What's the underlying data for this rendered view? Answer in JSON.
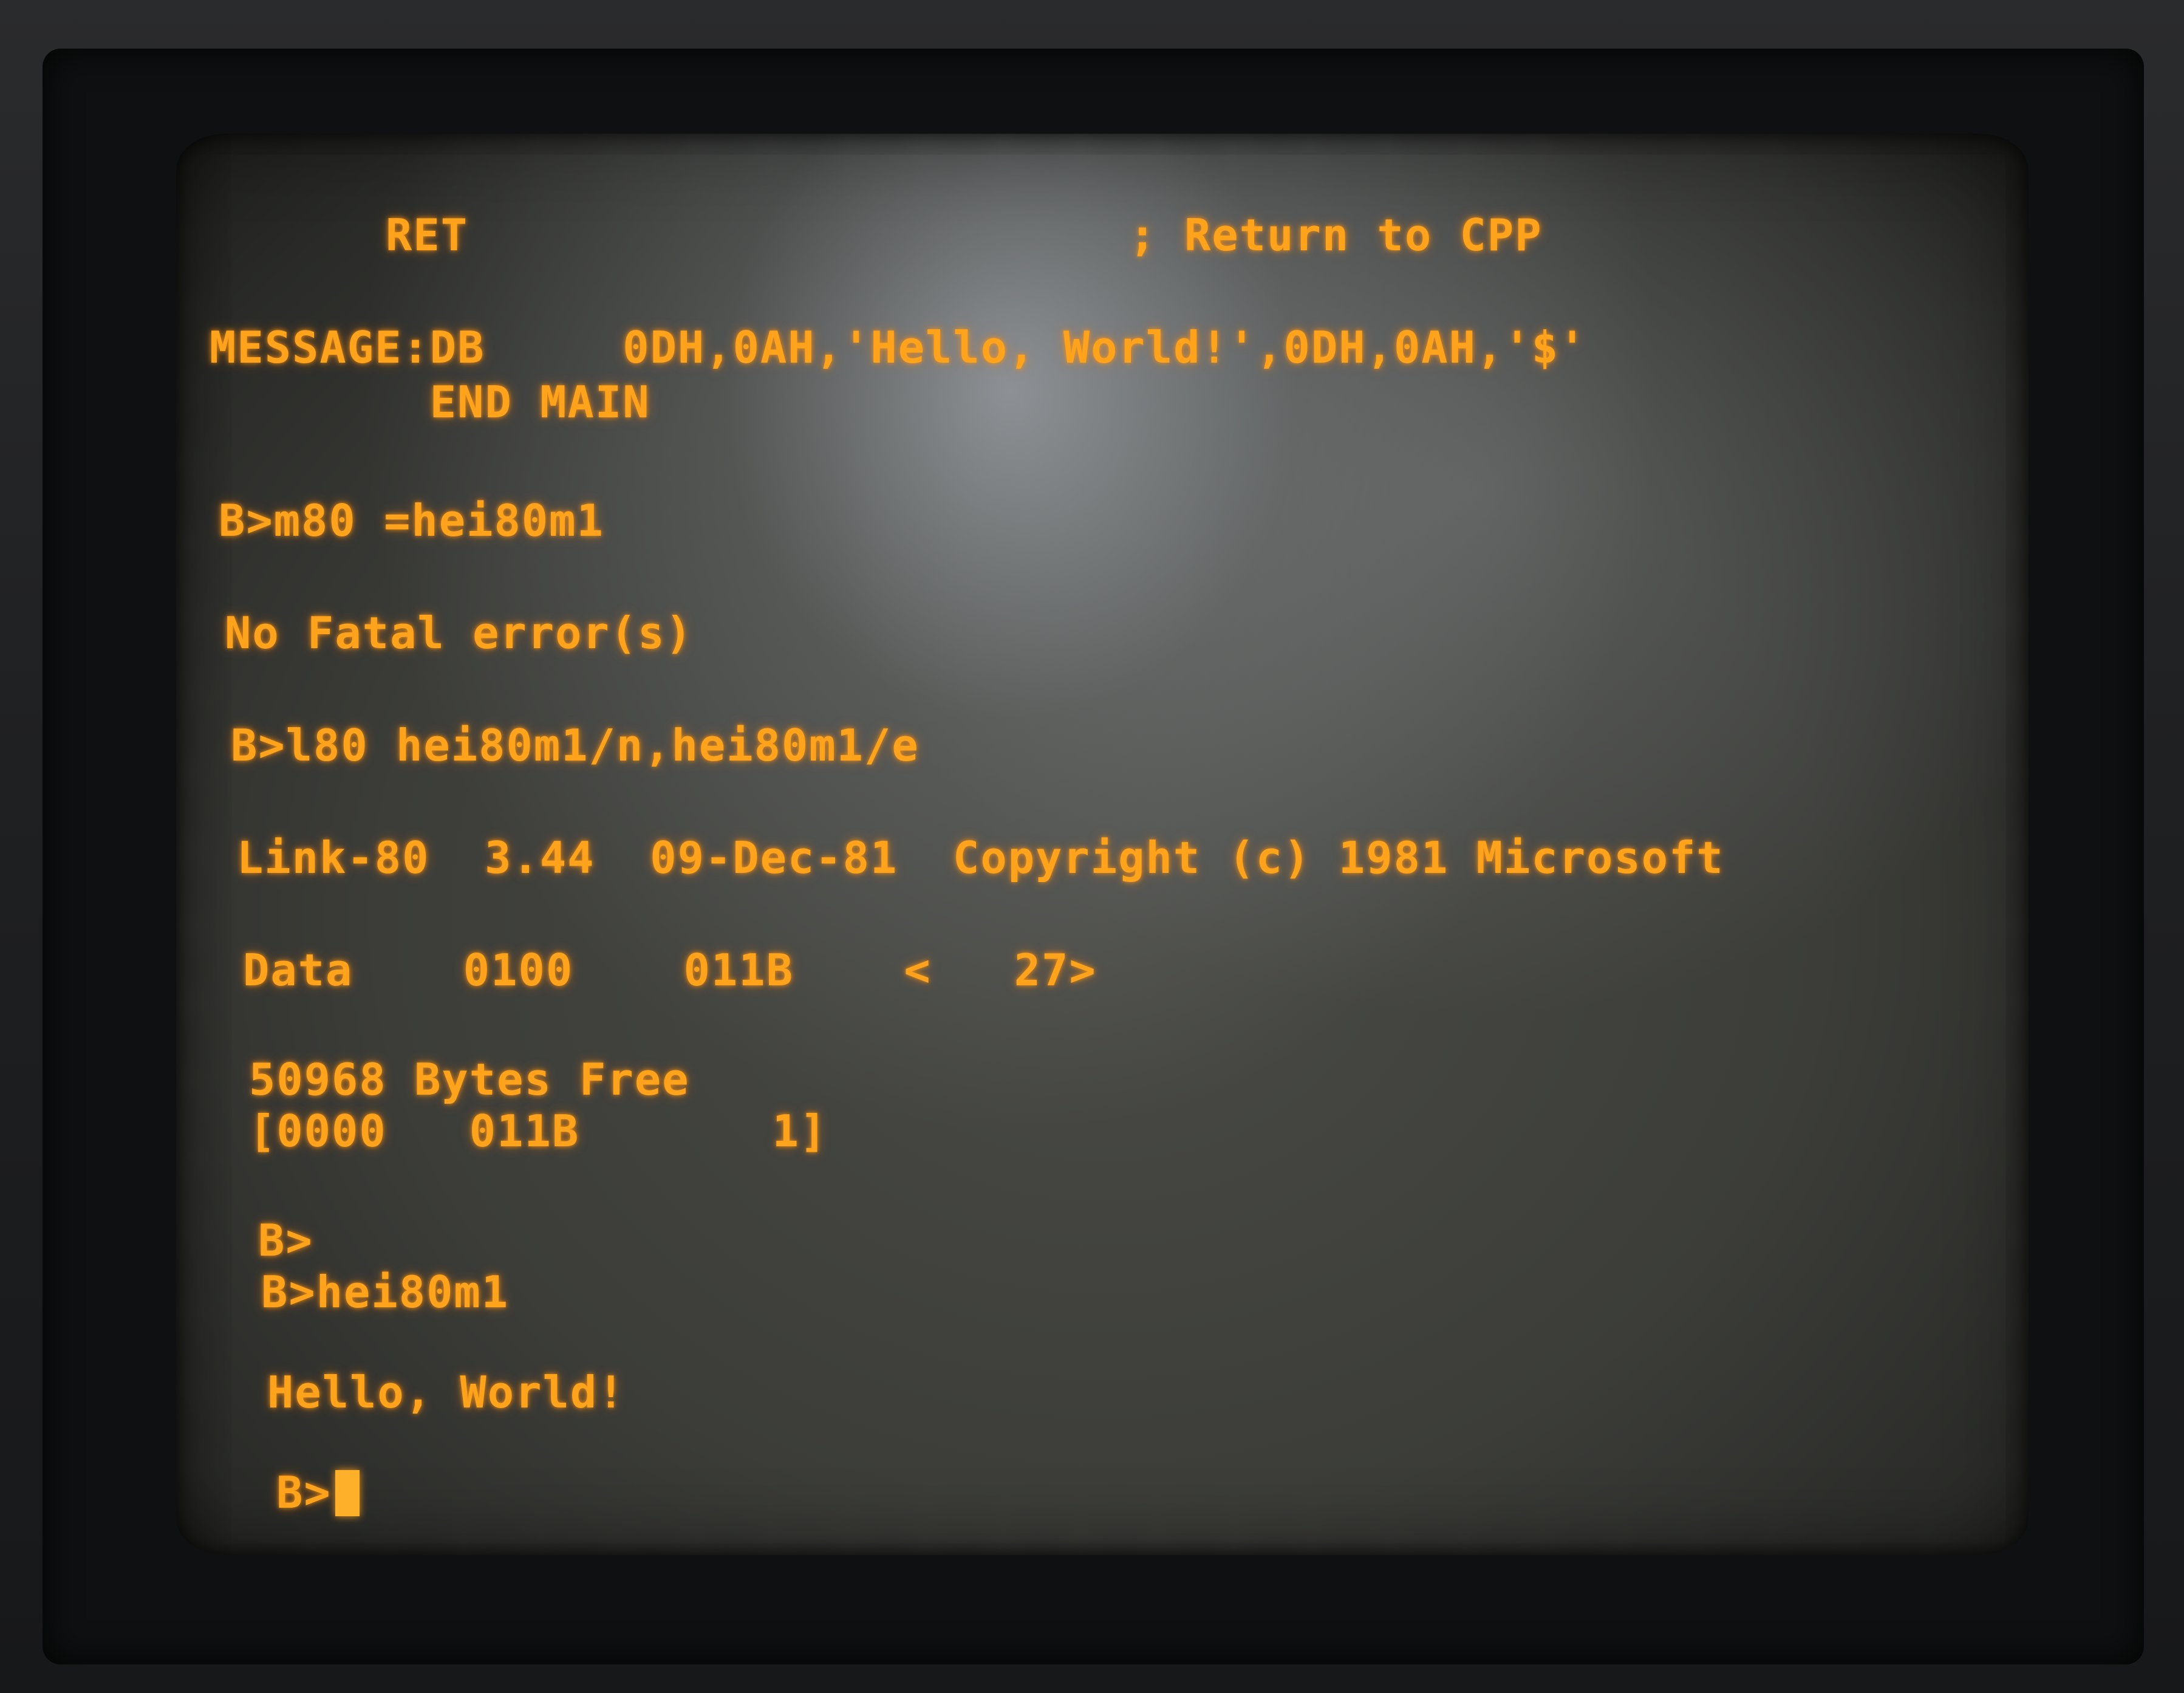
{
  "terminal": {
    "lines": [
      "RET                        ; Return to CPP",
      "MESSAGE:DB     0DH,0AH,'Hello, World!',0DH,0AH,'$'",
      "        END MAIN",
      "B>m80 =hei80m1",
      "No Fatal error(s)",
      "B>l80 hei80m1/n,hei80m1/e",
      "Link-80  3.44  09-Dec-81  Copyright (c) 1981 Microsoft",
      "Data    0100    011B    <   27>",
      "50968 Bytes Free",
      "[0000   011B       1]",
      "B>",
      "B>hei80m1",
      "Hello, World!",
      "B>"
    ]
  },
  "colors": {
    "phosphor": "#ffa21c",
    "screen": "#3c3d39",
    "bezel": "#1c1d1f"
  }
}
